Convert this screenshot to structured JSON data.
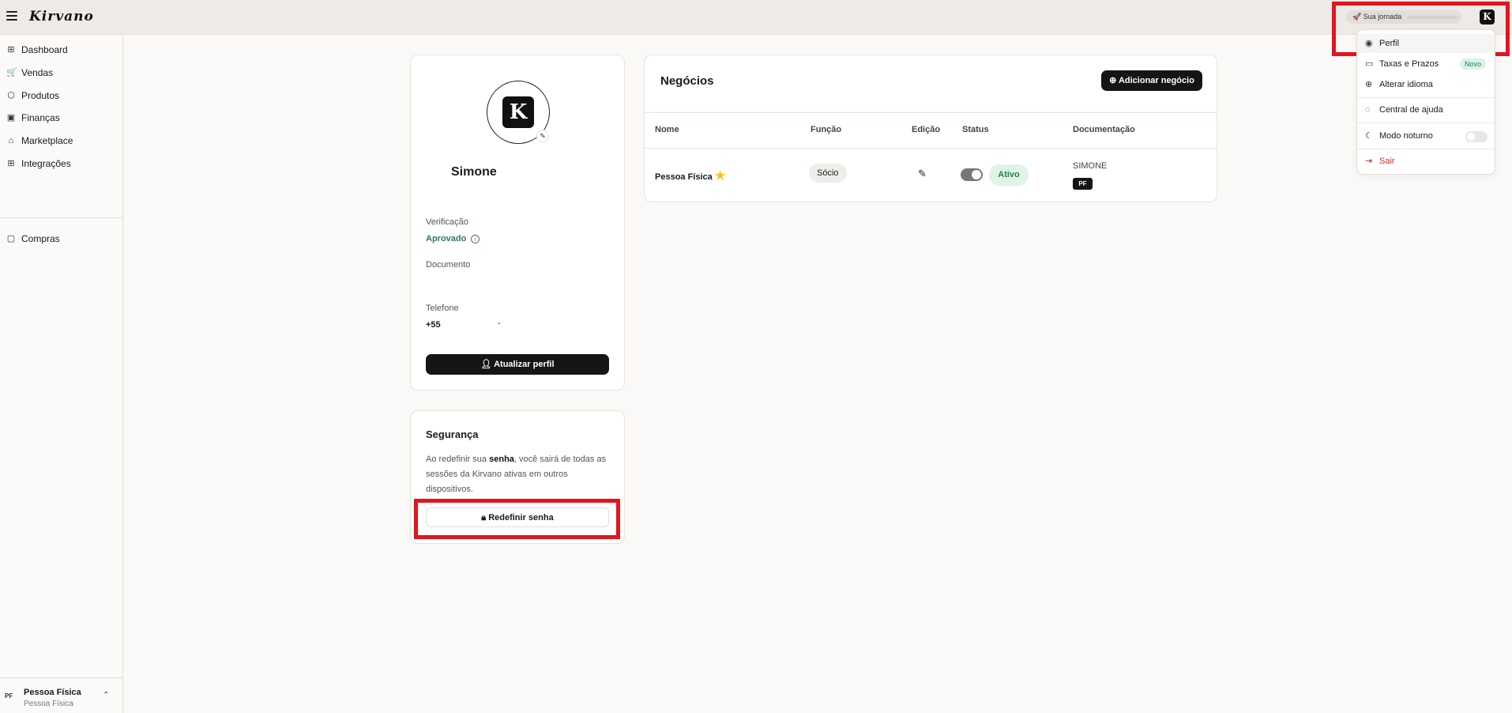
{
  "app": {
    "logo": "Kirvano"
  },
  "topbar": {
    "journey_label": "🚀 Sua jornada",
    "avatar_letter": "K"
  },
  "sidebar": {
    "items": [
      {
        "label": "Dashboard",
        "icon": "⊞"
      },
      {
        "label": "Vendas",
        "icon": "🛒"
      },
      {
        "label": "Produtos",
        "icon": "⬡"
      },
      {
        "label": "Finanças",
        "icon": "▣"
      },
      {
        "label": "Marketplace",
        "icon": "⌂"
      },
      {
        "label": "Integrações",
        "icon": "⊞"
      },
      {
        "label": "Compras",
        "icon": "▢"
      }
    ],
    "account": {
      "initials": "PF",
      "name": "Pessoa Física",
      "type": "Pessoa Física"
    }
  },
  "profile": {
    "avatar_letter": "K",
    "name": "Simone",
    "verification_label": "Verificação",
    "verification_value": "Aprovado",
    "document_label": "Documento",
    "phone_label": "Telefone",
    "phone_value": "+55",
    "phone_sep": "-",
    "update_button": "Atualizar perfil"
  },
  "security": {
    "title": "Segurança",
    "text_pre": "Ao redefinir sua ",
    "text_bold": "senha",
    "text_post": ", você sairá de todas as sessões da Kirvano ativas em outros dispositivos.",
    "reset_button": "Redefinir senha"
  },
  "business": {
    "title": "Negócios",
    "add_button": "Adicionar negócio",
    "columns": [
      "Nome",
      "Função",
      "Edição",
      "Status",
      "Documentação"
    ],
    "rows": [
      {
        "name": "Pessoa Física",
        "role": "Sócio",
        "status": "Ativo",
        "status_on": true,
        "doc_name": "SIMONE",
        "doc_badge": "PF"
      }
    ]
  },
  "user_menu": {
    "items": [
      {
        "label": "Perfil",
        "icon": "◉"
      },
      {
        "label": "Taxas e Prazos",
        "icon": "▭",
        "badge": "Novo"
      },
      {
        "label": "Alterar idioma",
        "icon": "⊕"
      },
      {
        "label": "Central de ajuda",
        "icon": "◌"
      },
      {
        "label": "Modo noturno",
        "icon": "☾",
        "toggle_on": false
      },
      {
        "label": "Sair",
        "icon": "⇥"
      }
    ]
  },
  "colors": {
    "accent_dark": "#151515",
    "success": "#2e7d4f",
    "danger": "#c4302b",
    "highlight": "#e0151f"
  }
}
